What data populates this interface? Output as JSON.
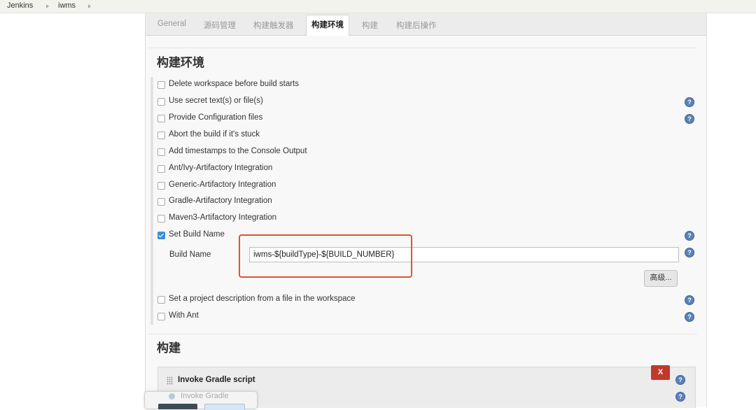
{
  "breadcrumb": [
    "Jenkins",
    "iwms"
  ],
  "tabs": [
    "General",
    "源码管理",
    "构建触发器",
    "构建环境",
    "构建",
    "构建后操作"
  ],
  "active_tab": "构建环境",
  "build_env": {
    "title": "构建环境",
    "options": [
      {
        "label": "Delete workspace before build starts",
        "checked": false,
        "help": false
      },
      {
        "label": "Use secret text(s) or file(s)",
        "checked": false,
        "help": true
      },
      {
        "label": "Provide Configuration files",
        "checked": false,
        "help": true
      },
      {
        "label": "Abort the build if it's stuck",
        "checked": false,
        "help": false
      },
      {
        "label": "Add timestamps to the Console Output",
        "checked": false,
        "help": false
      },
      {
        "label": "Ant/Ivy-Artifactory Integration",
        "checked": false,
        "help": false
      },
      {
        "label": "Generic-Artifactory Integration",
        "checked": false,
        "help": false
      },
      {
        "label": "Gradle-Artifactory Integration",
        "checked": false,
        "help": false
      },
      {
        "label": "Maven3-Artifactory Integration",
        "checked": false,
        "help": false
      },
      {
        "label": "Set Build Name",
        "checked": true,
        "help": true
      }
    ],
    "build_name_label": "Build Name",
    "build_name_value": "iwms-${buildType}-${BUILD_NUMBER}",
    "advanced_button": "高级...",
    "options_after": [
      {
        "label": "Set a project description from a file in the workspace",
        "checked": false,
        "help": true
      },
      {
        "label": "With Ant",
        "checked": false,
        "help": true
      }
    ]
  },
  "build": {
    "title": "构建",
    "step_title": "Invoke Gradle script",
    "delete_label": "X"
  },
  "popup": {
    "text": "Invoke Gradle"
  },
  "help_glyph": "?",
  "colors": {
    "highlight": "#e2532e",
    "checkbox_checked": "#3b8fde",
    "delete": "#c0392b",
    "help": "#5a82b8"
  }
}
